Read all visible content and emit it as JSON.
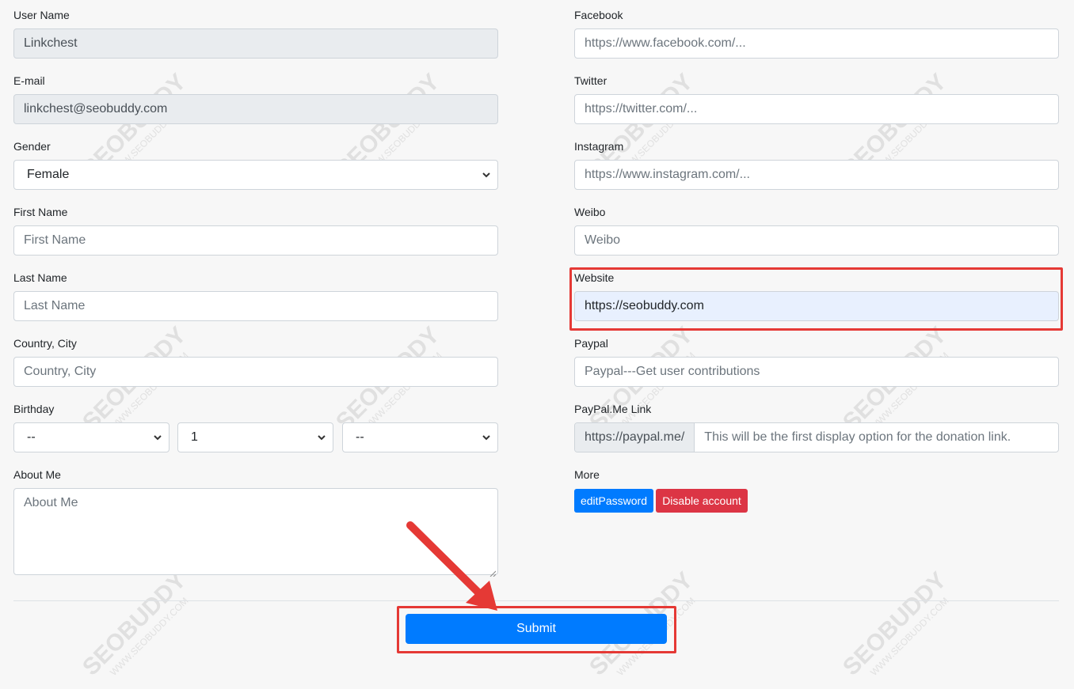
{
  "left": {
    "username": {
      "label": "User Name",
      "value": "Linkchest"
    },
    "email": {
      "label": "E-mail",
      "value": "linkchest@seobuddy.com"
    },
    "gender": {
      "label": "Gender",
      "value": "Female"
    },
    "first_name": {
      "label": "First Name",
      "placeholder": "First Name"
    },
    "last_name": {
      "label": "Last Name",
      "placeholder": "Last Name"
    },
    "country_city": {
      "label": "Country, City",
      "placeholder": "Country, City"
    },
    "birthday": {
      "label": "Birthday",
      "year": "--",
      "month": "1",
      "day": "--"
    },
    "about": {
      "label": "About Me",
      "placeholder": "About Me"
    }
  },
  "right": {
    "facebook": {
      "label": "Facebook",
      "placeholder": "https://www.facebook.com/..."
    },
    "twitter": {
      "label": "Twitter",
      "placeholder": "https://twitter.com/..."
    },
    "instagram": {
      "label": "Instagram",
      "placeholder": "https://www.instagram.com/..."
    },
    "weibo": {
      "label": "Weibo",
      "placeholder": "Weibo"
    },
    "website": {
      "label": "Website",
      "value": "https://seobuddy.com"
    },
    "paypal": {
      "label": "Paypal",
      "placeholder": "Paypal---Get user contributions"
    },
    "paypal_me": {
      "label": "PayPal.Me Link",
      "prefix": "https://paypal.me/",
      "placeholder": "This will be the first display option for the donation link."
    },
    "more": {
      "label": "More",
      "edit_password": "editPassword",
      "disable_account": "Disable account"
    }
  },
  "submit_label": "Submit",
  "watermark": {
    "brand": "SEOBUDDY",
    "domain": "WWW.SEOBUDDY.COM"
  },
  "colors": {
    "primary": "#007bff",
    "danger": "#dc3545",
    "annotation": "#e53935"
  }
}
